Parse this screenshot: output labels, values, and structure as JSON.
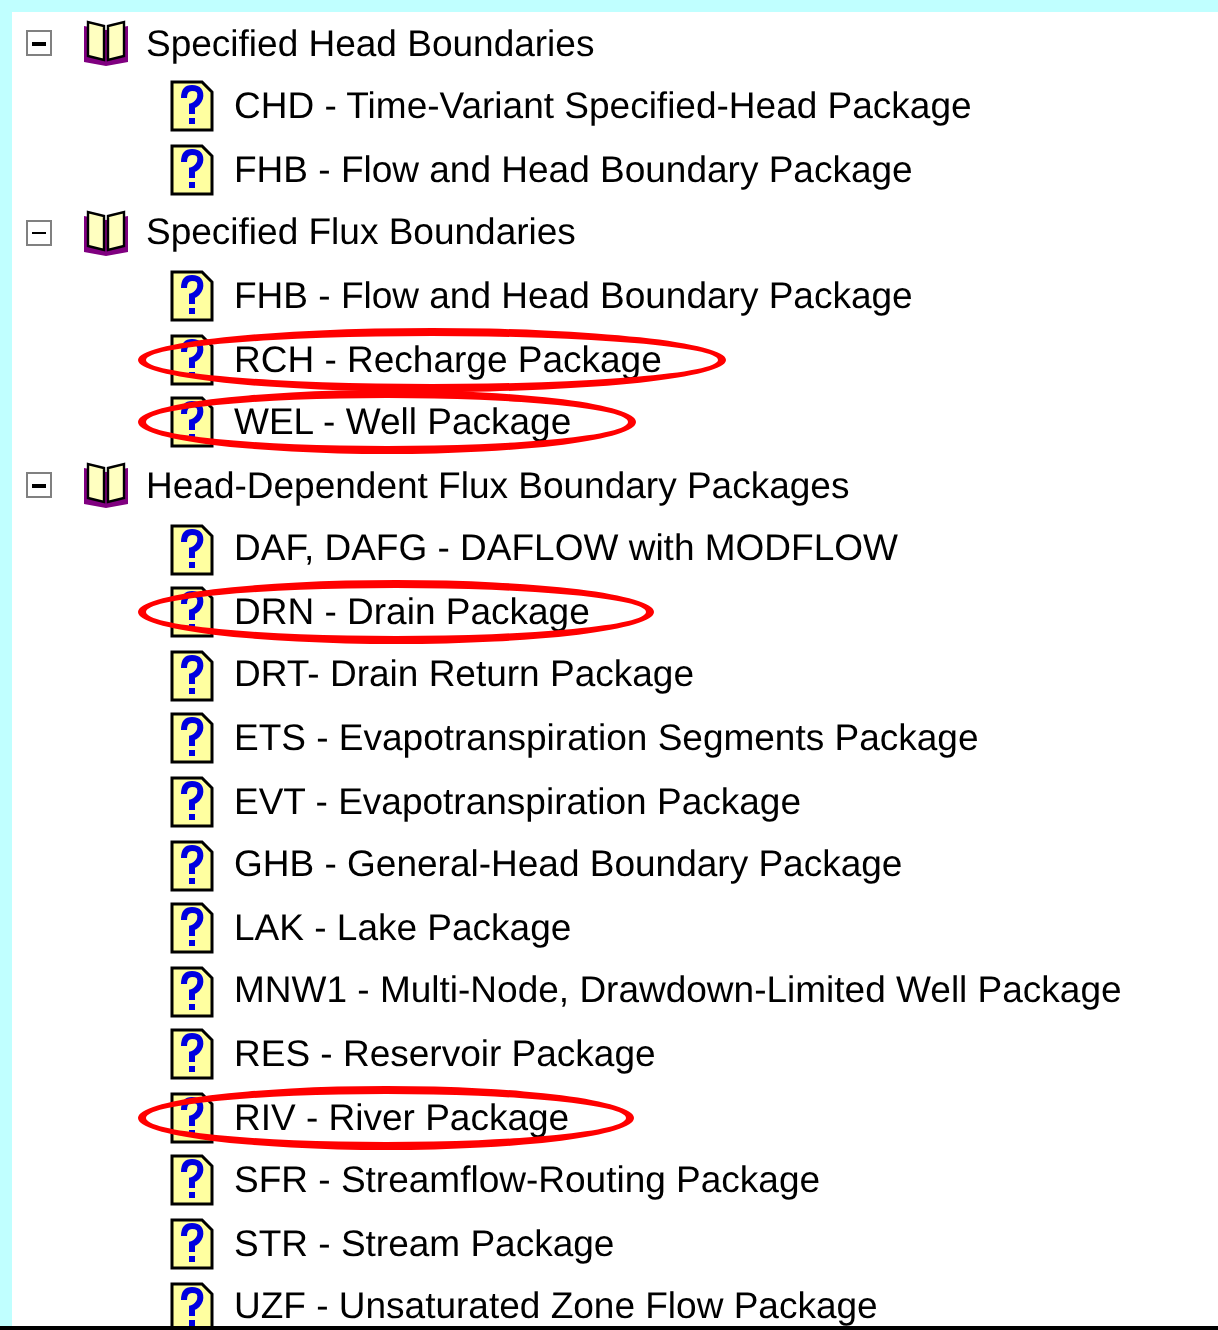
{
  "tree": [
    {
      "label": "Specified Head Boundaries",
      "expanded": true,
      "children": [
        {
          "label": "CHD - Time-Variant Specified-Head Package",
          "circled": false
        },
        {
          "label": "FHB - Flow and Head Boundary Package",
          "circled": false
        }
      ]
    },
    {
      "label": "Specified Flux Boundaries",
      "expanded": true,
      "children": [
        {
          "label": "FHB - Flow and Head Boundary Package",
          "circled": false
        },
        {
          "label": "RCH - Recharge Package",
          "circled": true
        },
        {
          "label": "WEL - Well Package",
          "circled": true
        }
      ]
    },
    {
      "label": "Head-Dependent Flux Boundary Packages",
      "expanded": true,
      "children": [
        {
          "label": "DAF, DAFG - DAFLOW with MODFLOW",
          "circled": false
        },
        {
          "label": "DRN - Drain Package",
          "circled": true
        },
        {
          "label": "DRT- Drain Return Package",
          "circled": false
        },
        {
          "label": "ETS - Evapotranspiration Segments Package",
          "circled": false
        },
        {
          "label": "EVT - Evapotranspiration Package",
          "circled": false
        },
        {
          "label": "GHB - General-Head Boundary Package",
          "circled": false
        },
        {
          "label": "LAK - Lake Package",
          "circled": false
        },
        {
          "label": "MNW1 - Multi-Node, Drawdown-Limited Well Package",
          "circled": false
        },
        {
          "label": "RES - Reservoir Package",
          "circled": false
        },
        {
          "label": "RIV - River Package",
          "circled": true
        },
        {
          "label": "SFR - Streamflow-Routing Package",
          "circled": false
        },
        {
          "label": "STR - Stream Package",
          "circled": false
        },
        {
          "label": "UZF - Unsaturated Zone Flow Package",
          "circled": false
        }
      ]
    }
  ]
}
